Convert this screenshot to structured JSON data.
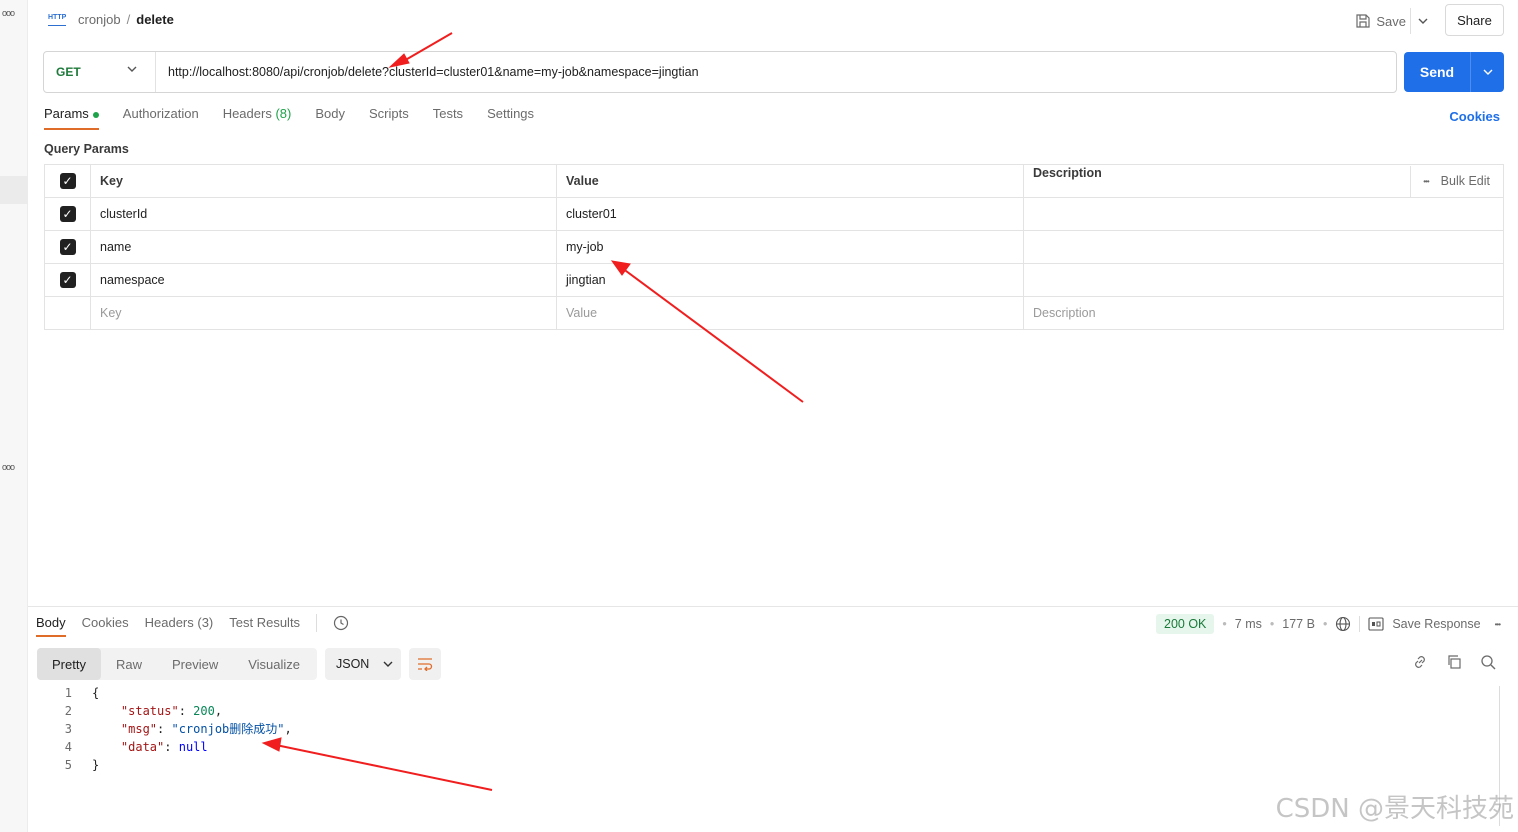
{
  "header": {
    "http_icon": "HTTP",
    "collection": "cronjob",
    "separator": "/",
    "request_name": "delete",
    "save_label": "Save",
    "share_label": "Share"
  },
  "request": {
    "method": "GET",
    "url": "http://localhost:8080/api/cronjob/delete?clusterId=cluster01&name=my-job&namespace=jingtian",
    "send_label": "Send"
  },
  "tabs": {
    "params": "Params",
    "authorization": "Authorization",
    "headers": "Headers",
    "headers_count": "(8)",
    "body": "Body",
    "scripts": "Scripts",
    "tests": "Tests",
    "settings": "Settings",
    "cookies": "Cookies"
  },
  "query_params": {
    "title": "Query Params",
    "columns": {
      "key": "Key",
      "value": "Value",
      "description": "Description",
      "bulk_edit": "Bulk Edit",
      "more": "•••"
    },
    "rows": [
      {
        "key": "clusterId",
        "value": "cluster01",
        "description": ""
      },
      {
        "key": "name",
        "value": "my-job",
        "description": ""
      },
      {
        "key": "namespace",
        "value": "jingtian",
        "description": ""
      }
    ],
    "placeholder": {
      "key": "Key",
      "value": "Value",
      "description": "Description"
    }
  },
  "response": {
    "tabs": {
      "body": "Body",
      "cookies": "Cookies",
      "headers": "Headers (3)",
      "test_results": "Test Results"
    },
    "status": "200 OK",
    "time": "7 ms",
    "size": "177 B",
    "save_response": "Save Response",
    "more": "•••",
    "view_tabs": [
      "Pretty",
      "Raw",
      "Preview",
      "Visualize"
    ],
    "format": "JSON",
    "code_lines": [
      {
        "n": "1",
        "text": "{"
      },
      {
        "n": "2",
        "key": "\"status\"",
        "value": "200",
        "type": "num",
        "trail": ","
      },
      {
        "n": "3",
        "key": "\"msg\"",
        "value": "\"cronjob删除成功\"",
        "type": "str",
        "trail": ","
      },
      {
        "n": "4",
        "key": "\"data\"",
        "value": "null",
        "type": "kw",
        "trail": ""
      },
      {
        "n": "5",
        "text": "}"
      }
    ]
  },
  "watermark": "CSDN @景天科技苑",
  "annotation_color": "#f01e1e"
}
